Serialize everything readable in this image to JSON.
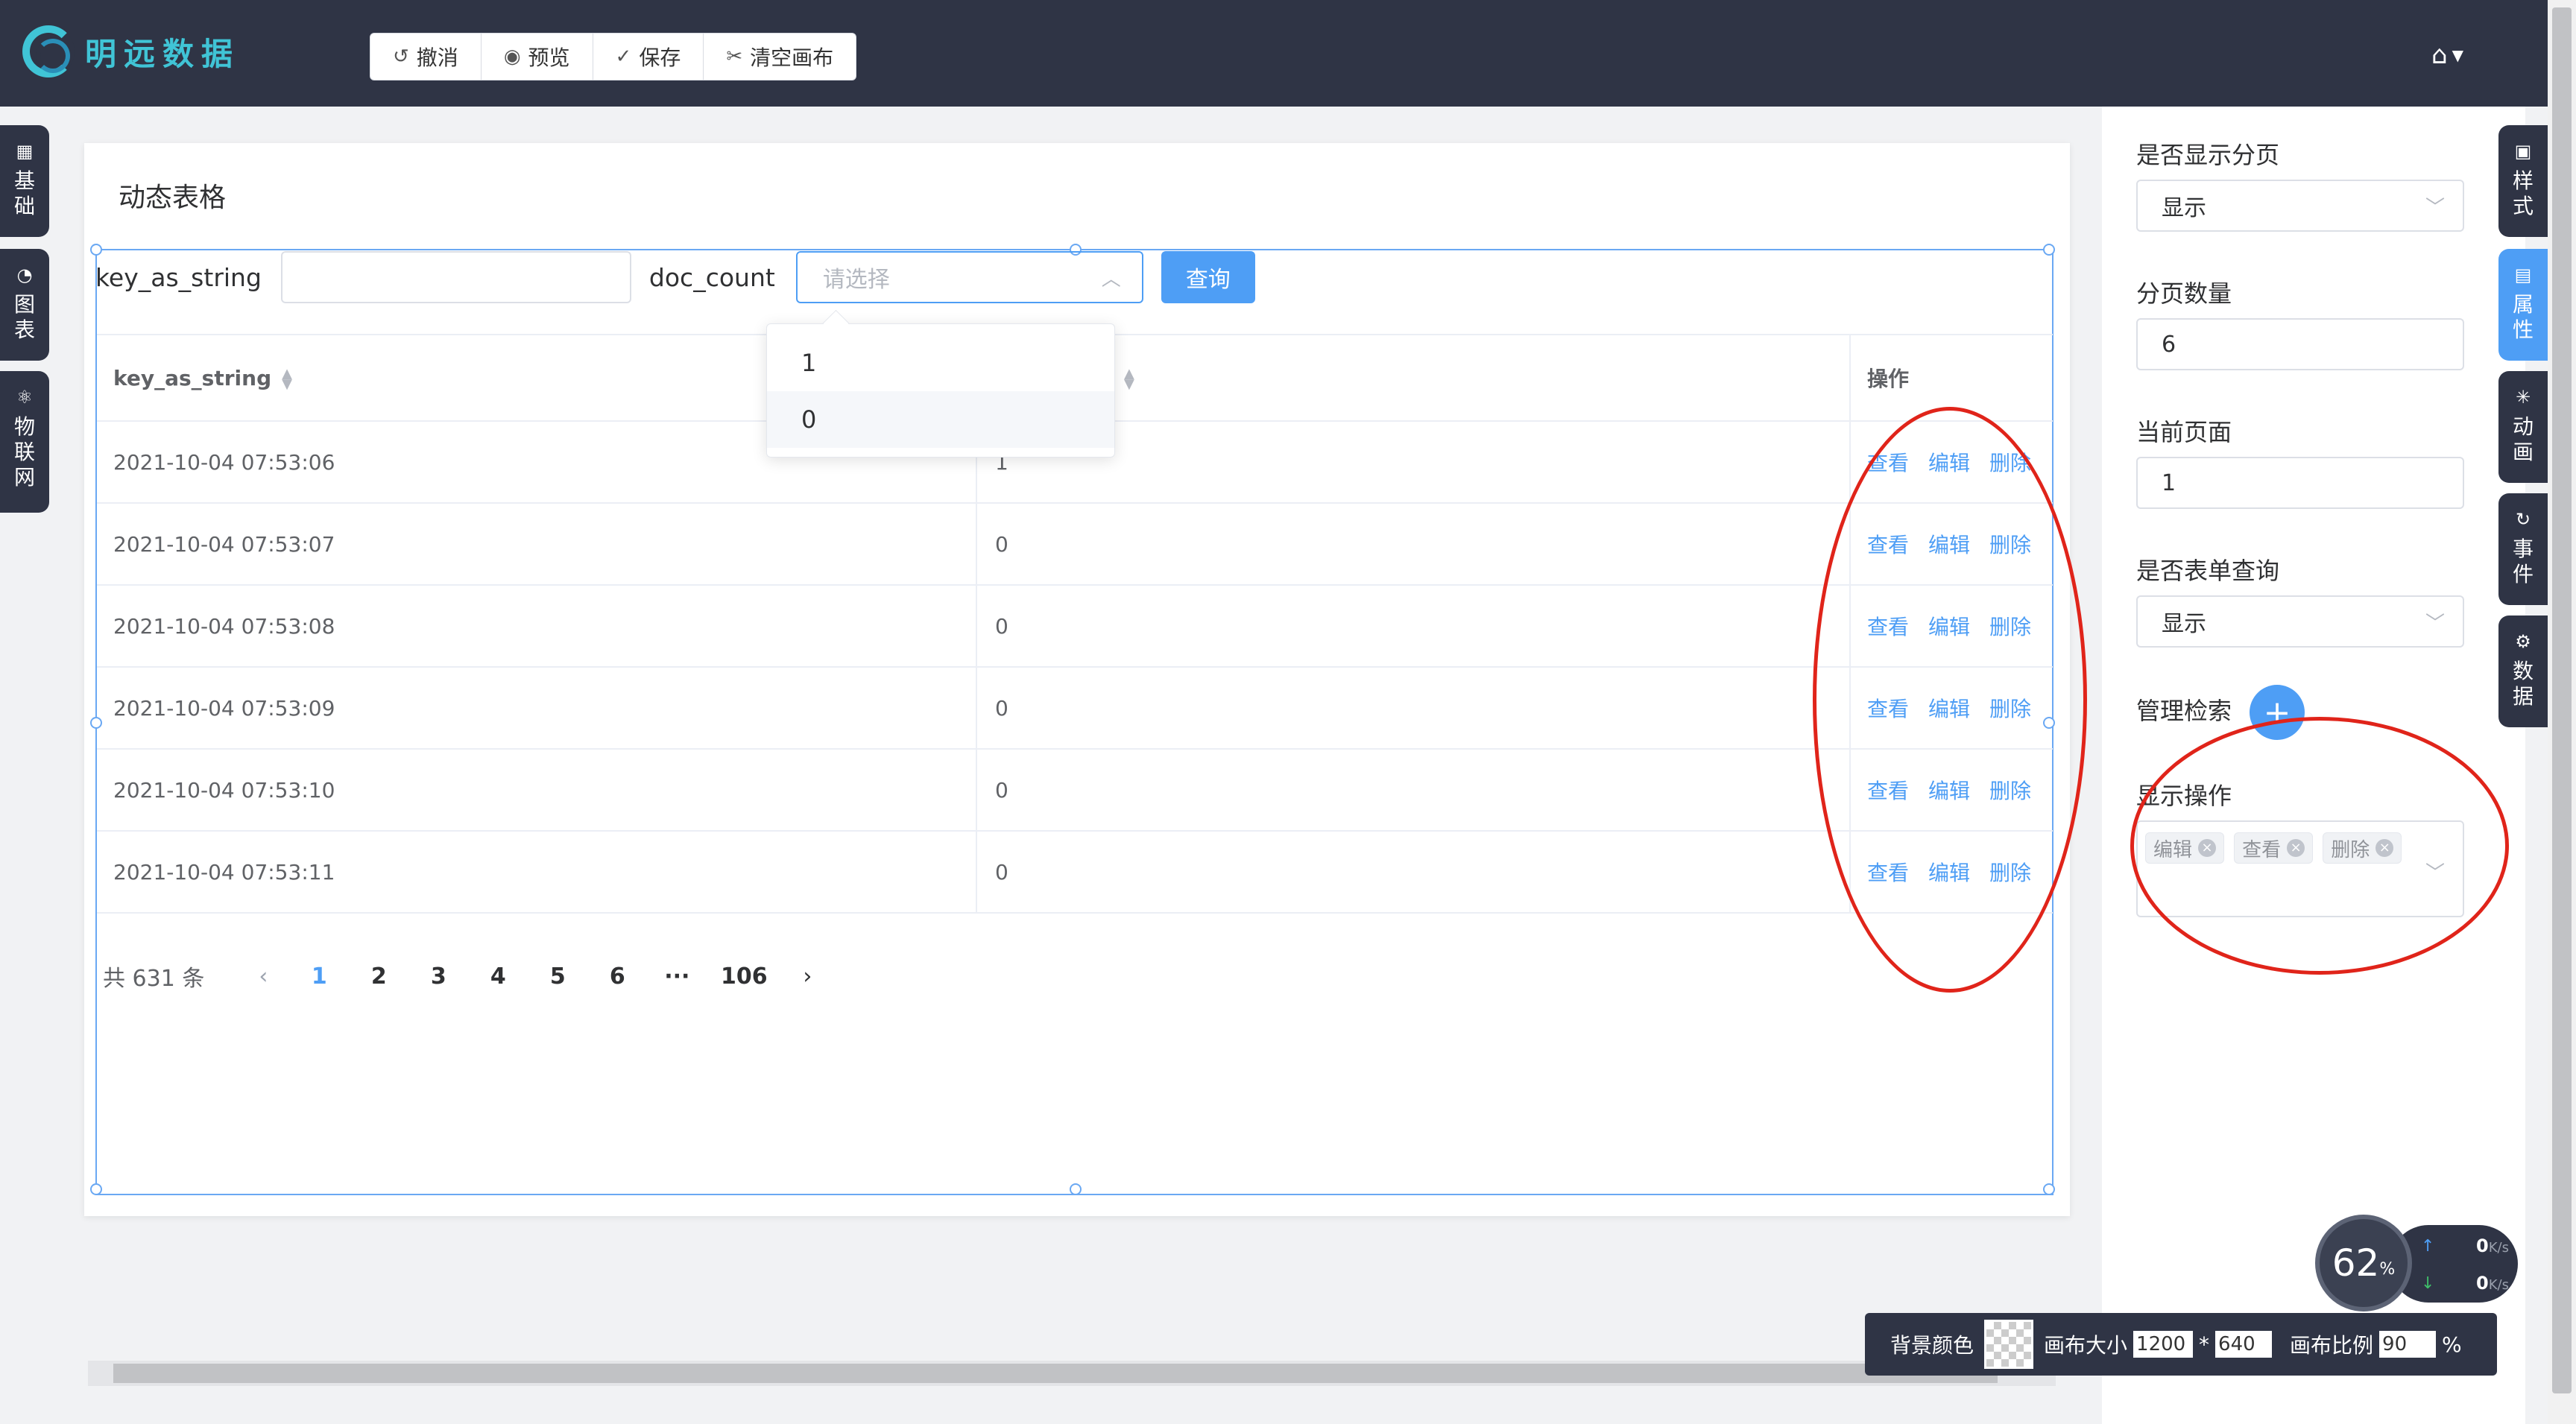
{
  "app": {
    "title": "明远数据"
  },
  "toolbar": {
    "undo": "撤消",
    "preview": "预览",
    "save": "保存",
    "clear": "清空画布"
  },
  "left_tabs": [
    {
      "icon": "grid-icon",
      "label": "基础"
    },
    {
      "icon": "chart-icon",
      "label": "图表"
    },
    {
      "icon": "iot-icon",
      "label": "物联网"
    }
  ],
  "right_tabs": [
    {
      "icon": "style-icon",
      "label": "样式",
      "active": false
    },
    {
      "icon": "attr-icon",
      "label": "属性",
      "active": true
    },
    {
      "icon": "anim-icon",
      "label": "动画",
      "active": false
    },
    {
      "icon": "event-icon",
      "label": "事件",
      "active": false
    },
    {
      "icon": "data-icon",
      "label": "数据",
      "active": false
    }
  ],
  "card": {
    "title": "动态表格"
  },
  "filter": {
    "label1": "key_as_string",
    "input1_value": "",
    "label2": "doc_count",
    "select_placeholder": "请选择",
    "query_button": "查询",
    "options": [
      "1",
      "0"
    ]
  },
  "table": {
    "columns": [
      "key_as_string",
      "doc_count",
      "操作"
    ],
    "rows": [
      [
        "2021-10-04 07:53:06",
        "1"
      ],
      [
        "2021-10-04 07:53:07",
        "0"
      ],
      [
        "2021-10-04 07:53:08",
        "0"
      ],
      [
        "2021-10-04 07:53:09",
        "0"
      ],
      [
        "2021-10-04 07:53:10",
        "0"
      ],
      [
        "2021-10-04 07:53:11",
        "0"
      ]
    ],
    "actions": [
      "查看",
      "编辑",
      "删除"
    ]
  },
  "pager": {
    "total": "共 631 条",
    "pages": [
      "1",
      "2",
      "3",
      "4",
      "5",
      "6",
      "···",
      "106"
    ],
    "current": "1"
  },
  "panel": {
    "show_pager_label": "是否显示分页",
    "show_pager_value": "显示",
    "page_size_label": "分页数量",
    "page_size_value": "6",
    "current_page_label": "当前页面",
    "current_page_value": "1",
    "form_query_label": "是否表单查询",
    "form_query_value": "显示",
    "manage_search_label": "管理检索",
    "show_ops_label": "显示操作",
    "tags": [
      "编辑",
      "查看",
      "删除"
    ]
  },
  "speed": {
    "percent": "62",
    "unit": "%",
    "up": "0",
    "down": "0",
    "rate_unit": "K/s"
  },
  "canvas_bar": {
    "bg_label": "背景颜色",
    "size_label": "画布大小",
    "width": "1200",
    "times": "*",
    "height": "640",
    "ratio_label": "画布比例",
    "ratio": "90",
    "percent": "%"
  }
}
